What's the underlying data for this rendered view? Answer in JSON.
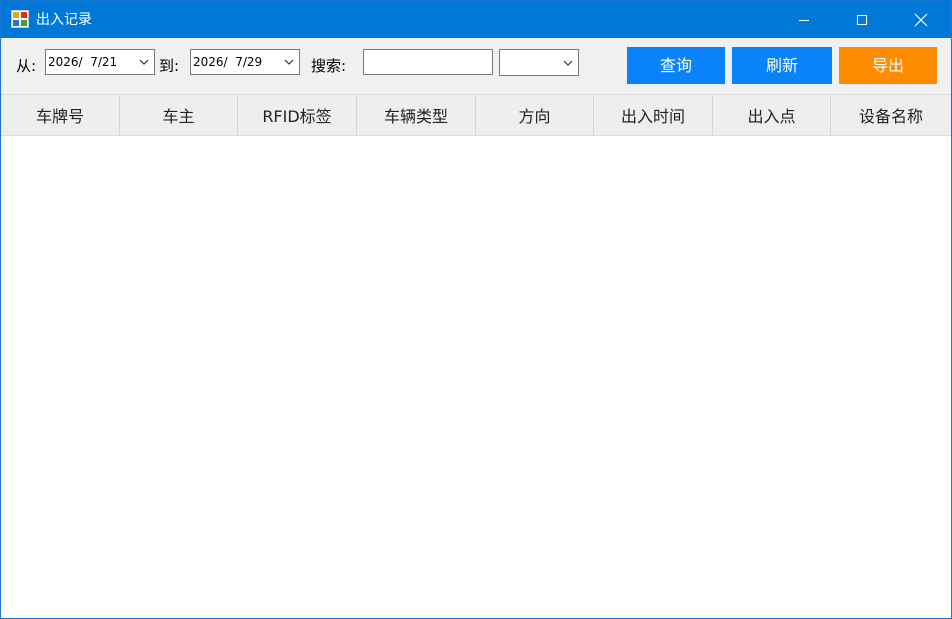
{
  "window": {
    "title": "出入记录",
    "minimize_glyph": "—",
    "maximize_glyph": "☐",
    "close_glyph": "✕"
  },
  "toolbar": {
    "from_label": "从:",
    "from_date": "2026/  7/21",
    "to_label": "到:",
    "to_date": "2026/  7/29",
    "search_label": "搜索:",
    "search_value": "",
    "filter_selected": "",
    "query_button": "查询",
    "refresh_button": "刷新",
    "export_button": "导出"
  },
  "colors": {
    "titlebar": "#0078d7",
    "button_blue": "#0a82fa",
    "button_orange": "#ff8c00"
  },
  "grid": {
    "columns": [
      "车牌号",
      "车主",
      "RFID标签",
      "车辆类型",
      "方向",
      "出入时间",
      "出入点",
      "设备名称"
    ],
    "rows": []
  }
}
